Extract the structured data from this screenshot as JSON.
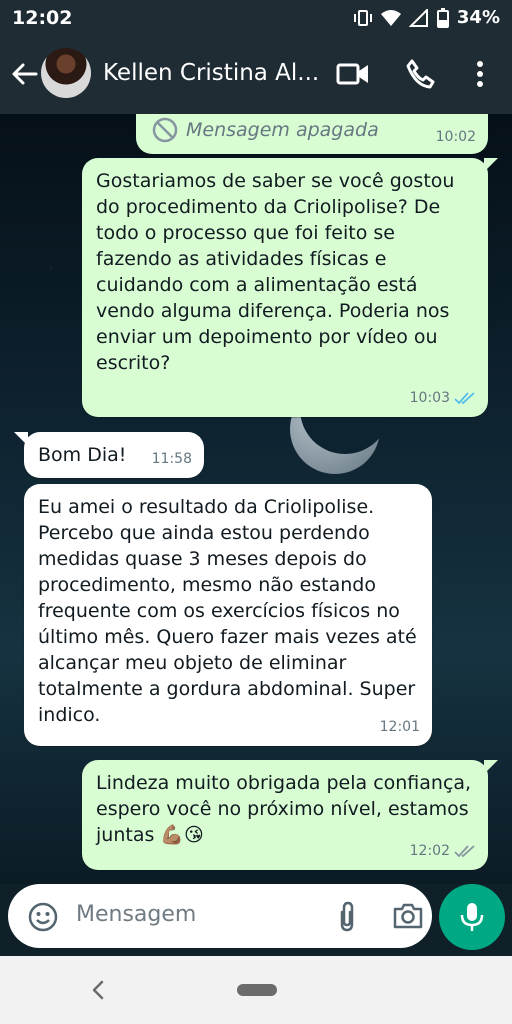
{
  "status_bar": {
    "time": "12:02",
    "battery": "34%"
  },
  "header": {
    "contact_name": "Kellen Cristina Al..."
  },
  "messages": [
    {
      "type": "deleted",
      "direction": "out",
      "text": "Mensagem apagada",
      "time": "10:02"
    },
    {
      "type": "text",
      "direction": "out",
      "text": "Gostariamos de saber se você gostou do procedimento da Criolipolise? De todo o processo que foi feito se fazendo as atividades físicas e cuidando com a alimentação está vendo alguma diferença. Poderia nos enviar um depoimento por vídeo ou escrito?",
      "time": "10:03",
      "read": true
    },
    {
      "type": "text",
      "direction": "in",
      "text": "Bom Dia!",
      "time": "11:58"
    },
    {
      "type": "text",
      "direction": "in",
      "text": "Eu amei o resultado da Criolipolise. Percebo que ainda estou perdendo medidas quase 3 meses depois do procedimento, mesmo não estando frequente com os exercícios físicos no último mês. Quero fazer mais vezes até alcançar meu objeto de eliminar totalmente a gordura abdominal. Super indico.",
      "time": "12:01"
    },
    {
      "type": "text",
      "direction": "out",
      "text": "Lindeza muito obrigada pela confiança, espero você no próximo nível, estamos juntas 💪🏽😘",
      "time": "12:02",
      "read": false
    }
  ],
  "composer": {
    "placeholder": "Mensagem"
  },
  "colors": {
    "header_bg": "#1f2c34",
    "out_bubble": "#d9fdd3",
    "in_bubble": "#ffffff",
    "accent": "#00a884",
    "read_ticks": "#53bdeb"
  }
}
